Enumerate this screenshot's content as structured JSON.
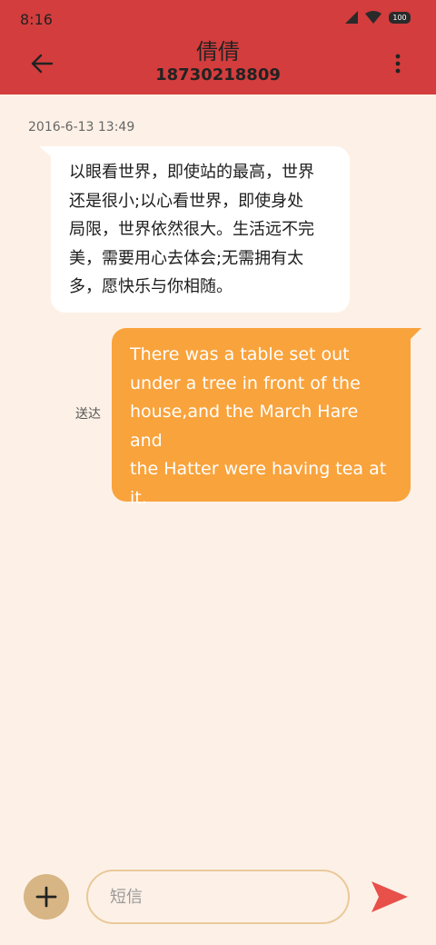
{
  "status_bar": {
    "time": "8:16",
    "battery": "100"
  },
  "header": {
    "name": "倩倩",
    "number": "18730218809"
  },
  "conversation": {
    "timestamp": "2016-6-13 13:49",
    "incoming": [
      "以眼看世界，即使站的最高，世界",
      "还是很小;以心看世界，即使身处",
      "局限，世界依然很大。生活远不完",
      "美，需要用心去体会;无需拥有太",
      "多，愿快乐与你相随。"
    ],
    "outgoing": [
      "There was a table set out",
      "under a tree in front of the",
      "house,and the March Hare and",
      "the Hatter were having tea at",
      "it."
    ],
    "outgoing_status": "送达"
  },
  "composer": {
    "placeholder": "短信",
    "value": ""
  },
  "colors": {
    "header": "#d43d3d",
    "background": "#fdf1e7",
    "outgoing_bubble": "#f9a33c",
    "incoming_bubble": "#ffffff",
    "add_button": "#d7b584",
    "send_icon": "#e8504a"
  },
  "icons": {
    "back": "arrow-left-icon",
    "more": "more-vertical-icon",
    "add": "plus-icon",
    "send": "send-icon"
  }
}
